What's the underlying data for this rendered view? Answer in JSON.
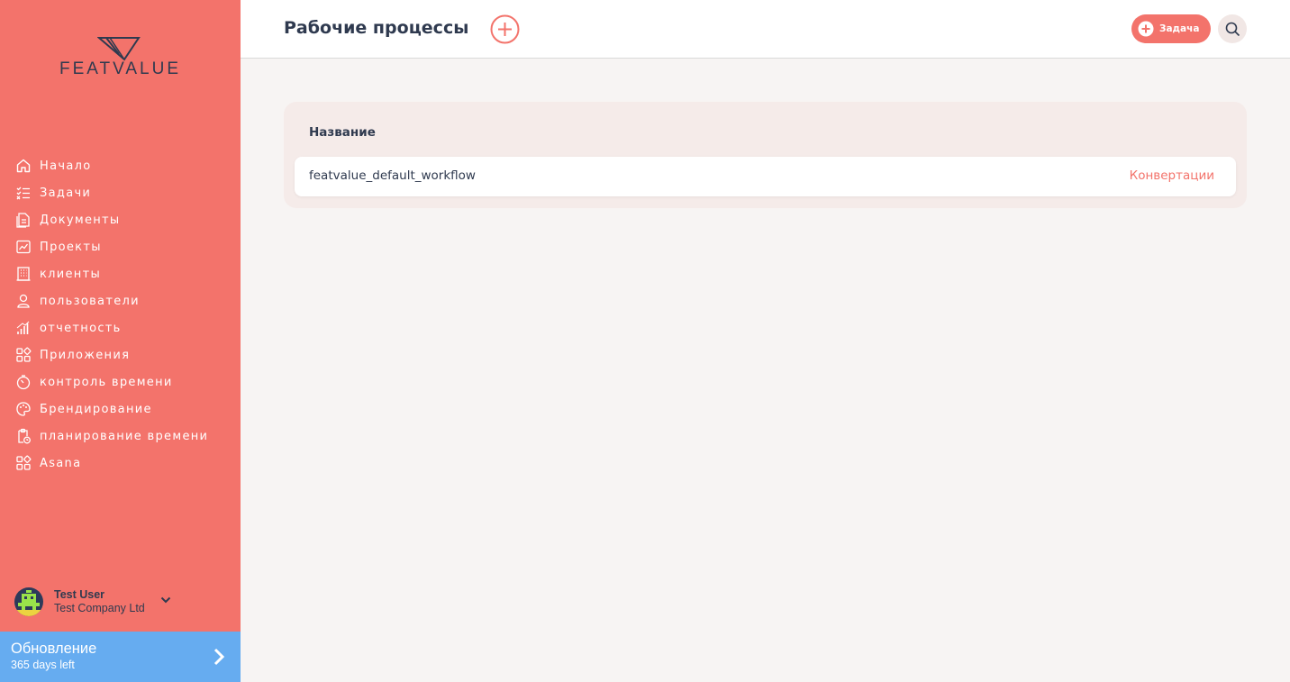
{
  "brand": {
    "logo_text": "FEATVALUE"
  },
  "sidebar": {
    "items": [
      {
        "label": "Начало",
        "icon": "home-icon"
      },
      {
        "label": "Задачи",
        "icon": "task-list-icon"
      },
      {
        "label": "Документы",
        "icon": "document-icon"
      },
      {
        "label": "Проекты",
        "icon": "chart-board-icon"
      },
      {
        "label": "клиенты",
        "icon": "building-icon"
      },
      {
        "label": "пользователи",
        "icon": "user-icon"
      },
      {
        "label": "отчетность",
        "icon": "bar-chart-icon"
      },
      {
        "label": "Приложения",
        "icon": "apps-grid-icon"
      },
      {
        "label": "контроль времени",
        "icon": "stopwatch-icon"
      },
      {
        "label": "Брендирование",
        "icon": "palette-icon"
      },
      {
        "label": "планирование времени",
        "icon": "clipboard-clock-icon"
      },
      {
        "label": "Asana",
        "icon": "apps-grid-icon"
      }
    ]
  },
  "user": {
    "name": "Test User",
    "company": "Test Company Ltd"
  },
  "upgrade": {
    "title": "Обновление",
    "subtitle": "365 days left"
  },
  "header": {
    "title": "Рабочие процессы",
    "task_button": "Задача"
  },
  "table": {
    "column_header": "Название",
    "rows": [
      {
        "name": "featvalue_default_workflow",
        "action": "Конвертации"
      }
    ]
  },
  "colors": {
    "accent": "#f3736b",
    "upgrade": "#66acf0",
    "text": "#2f3a4f",
    "background": "#f7f4f3"
  }
}
